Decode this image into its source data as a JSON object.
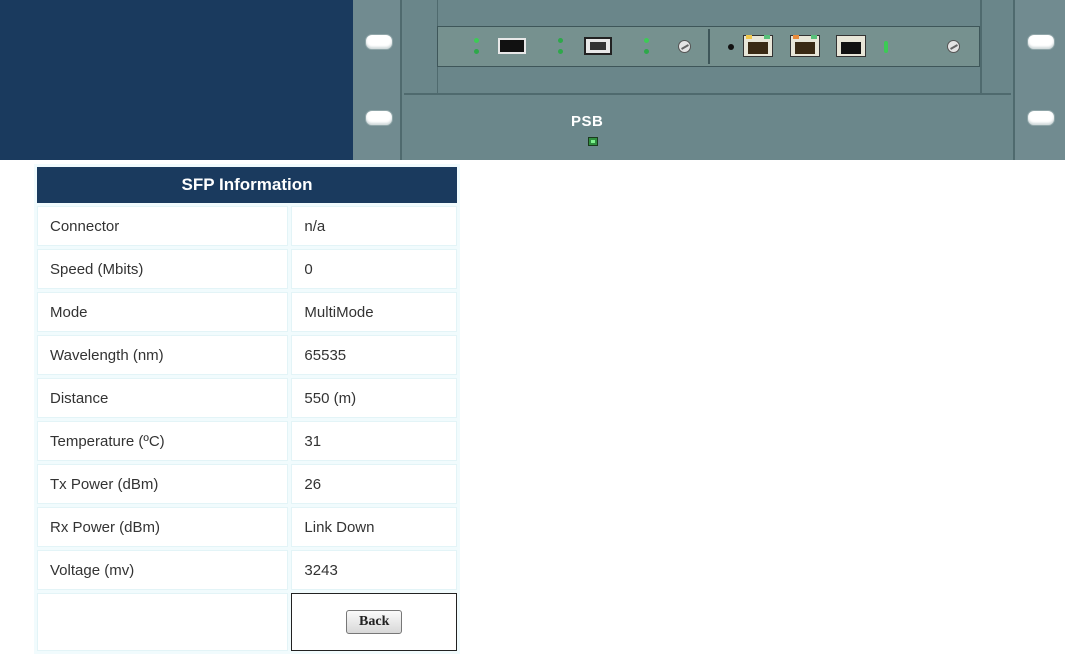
{
  "device": {
    "slot_label": "PSB"
  },
  "sfp_info": {
    "title": "SFP Information",
    "rows": [
      {
        "label": "Connector",
        "value": "n/a"
      },
      {
        "label": "Speed (Mbits)",
        "value": "0"
      },
      {
        "label": "Mode",
        "value": "MultiMode"
      },
      {
        "label": "Wavelength (nm)",
        "value": "65535"
      },
      {
        "label": "Distance",
        "value": "550 (m)"
      },
      {
        "label": "Temperature (ºC)",
        "value": "31"
      },
      {
        "label": "Tx Power (dBm)",
        "value": "26"
      },
      {
        "label": "Rx Power (dBm)",
        "value": "Link Down"
      },
      {
        "label": "Voltage (mv)",
        "value": "3243"
      }
    ],
    "back_label": "Back"
  },
  "colors": {
    "header_navy": "#1a3a5e",
    "chassis_gray": "#6b878b",
    "led_green": "#3ccb55"
  }
}
